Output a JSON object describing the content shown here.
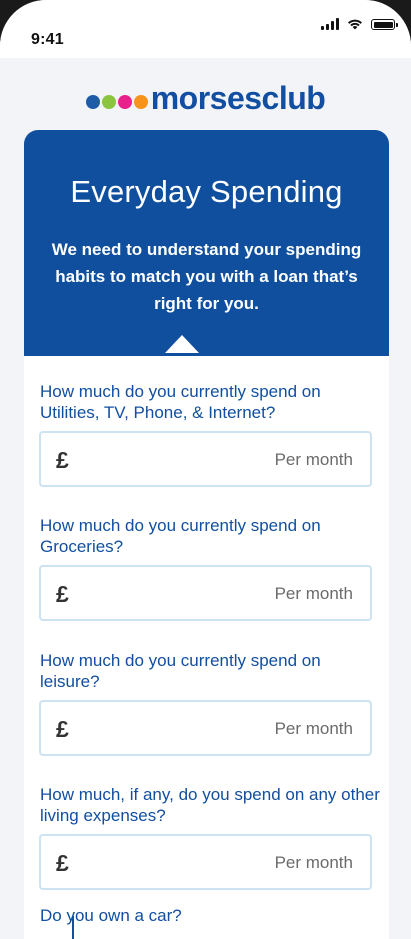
{
  "status_bar": {
    "time": "9:41"
  },
  "brand": {
    "logo_text": "morsesclub",
    "dot_colors": [
      "#1f5ca8",
      "#8bc53f",
      "#e8218b",
      "#f7931d"
    ]
  },
  "form": {
    "title": "Everyday Spending",
    "subtitle": "We need to understand your spending habits to match you with a loan that’s right for you.",
    "currency_symbol": "£",
    "questions": [
      {
        "label": "How much do you currently spend on Utilities, TV, Phone, & Internet?",
        "placeholder": "Per month",
        "value": ""
      },
      {
        "label": "How much do you currently spend on Groceries?",
        "placeholder": "Per month",
        "value": ""
      },
      {
        "label": "How much do you currently spend on leisure?",
        "placeholder": "Per month",
        "value": ""
      },
      {
        "label": "How much, if any, do you spend on any other living expenses?",
        "placeholder": "Per month",
        "value": ""
      }
    ],
    "car_question": "Do you own a car?"
  },
  "colors": {
    "brand_blue": "#104f9e",
    "question_blue": "#124fa0",
    "field_border": "#cde3f2"
  },
  "icons": [
    "signal-icon",
    "wifi-icon",
    "battery-icon"
  ]
}
